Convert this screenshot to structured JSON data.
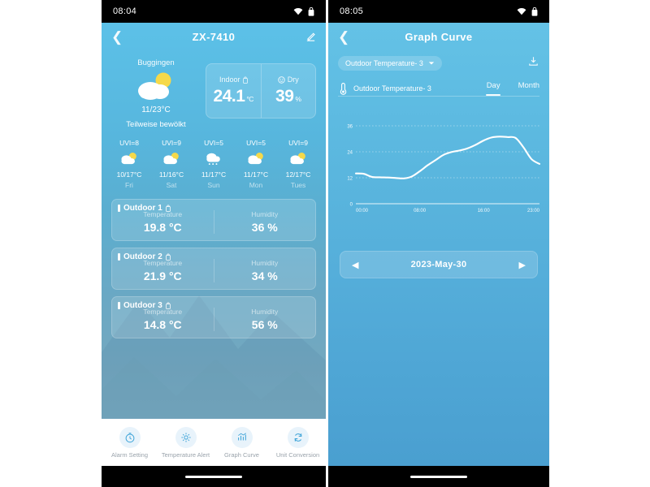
{
  "left_phone": {
    "status": {
      "time": "08:04",
      "wifi_icon": "wifi-icon",
      "battery_icon": "battery-icon"
    },
    "header": {
      "back_icon": "chevron-left-icon",
      "title": "ZX-7410",
      "edit_icon": "edit-pencil-icon"
    },
    "weather": {
      "city": "Buggingen",
      "icon": "sun-behind-cloud-icon",
      "range": "11/23°C",
      "description": "Teilweise bewölkt"
    },
    "indoor_card": {
      "left": {
        "label": "Indoor",
        "icon": "battery-icon",
        "value": "24.1",
        "unit": "°C"
      },
      "right": {
        "label": "Dry",
        "icon": "smiley-face-icon",
        "value": "39",
        "unit": "%"
      }
    },
    "forecast": [
      {
        "uvi": "UVI=8",
        "icon": "sun-behind-cloud-icon",
        "temp": "10/17°C",
        "day": "Fri"
      },
      {
        "uvi": "UVI=9",
        "icon": "sun-behind-cloud-icon",
        "temp": "11/16°C",
        "day": "Sat"
      },
      {
        "uvi": "UVI=5",
        "icon": "rain-cloud-icon",
        "temp": "11/17°C",
        "day": "Sun"
      },
      {
        "uvi": "UVI=5",
        "icon": "sun-behind-cloud-icon",
        "temp": "11/17°C",
        "day": "Mon"
      },
      {
        "uvi": "UVI=9",
        "icon": "sun-behind-cloud-icon",
        "temp": "12/17°C",
        "day": "Tues"
      }
    ],
    "sensors": [
      {
        "name": "Outdoor 1",
        "battery_icon": "battery-icon",
        "temperature_label": "Temperature",
        "temperature_value": "19.8 °C",
        "humidity_label": "Humidity",
        "humidity_value": "36 %"
      },
      {
        "name": "Outdoor 2",
        "battery_icon": "battery-icon",
        "temperature_label": "Temperature",
        "temperature_value": "21.9 °C",
        "humidity_label": "Humidity",
        "humidity_value": "34 %"
      },
      {
        "name": "Outdoor 3",
        "battery_icon": "battery-icon",
        "temperature_label": "Temperature",
        "temperature_value": "14.8 °C",
        "humidity_label": "Humidity",
        "humidity_value": "56 %"
      }
    ],
    "tabbar": [
      {
        "icon": "stopwatch-icon",
        "label": "Alarm Setting"
      },
      {
        "icon": "gear-icon",
        "label": "Temperature Alert"
      },
      {
        "icon": "chart-bars-icon",
        "label": "Graph Curve"
      },
      {
        "icon": "refresh-icon",
        "label": "Unit Conversion"
      }
    ]
  },
  "right_phone": {
    "status": {
      "time": "08:05",
      "wifi_icon": "wifi-icon",
      "battery_icon": "battery-icon"
    },
    "header": {
      "back_icon": "chevron-left-icon",
      "title": "Graph Curve"
    },
    "toolbar": {
      "dropdown_label": "Outdoor Temperature- 3",
      "dropdown_caret": "chevron-down-icon",
      "download_icon": "download-icon"
    },
    "legend": {
      "thermometer_icon": "thermometer-icon",
      "series_name": "Outdoor Temperature- 3",
      "range_tabs": [
        {
          "label": "Day",
          "active": true
        },
        {
          "label": "Month",
          "active": false
        }
      ]
    },
    "date_nav": {
      "prev_icon": "triangle-left-icon",
      "label": "2023-May-30",
      "next_icon": "triangle-right-icon"
    }
  },
  "chart_data": {
    "type": "line",
    "title": "Outdoor Temperature- 3",
    "xlabel": "",
    "ylabel": "",
    "grid": true,
    "legend_position": "top-left",
    "line_color": "#ffffff",
    "ylim": [
      0,
      36
    ],
    "yticks": [
      0,
      12,
      24,
      36
    ],
    "xticks": [
      "00:00",
      "08:00",
      "16:00",
      "23:00"
    ],
    "x": [
      "00:00",
      "01:00",
      "02:00",
      "03:00",
      "04:00",
      "05:00",
      "06:00",
      "07:00",
      "08:00",
      "09:00",
      "10:00",
      "11:00",
      "12:00",
      "13:00",
      "14:00",
      "15:00",
      "16:00",
      "17:00",
      "18:00",
      "19:00",
      "20:00",
      "21:00",
      "22:00",
      "23:00"
    ],
    "series": [
      {
        "name": "Outdoor Temperature- 3",
        "values": [
          14.0,
          13.8,
          12.4,
          12.2,
          12.1,
          11.9,
          11.7,
          12.6,
          15.0,
          17.8,
          20.2,
          22.6,
          23.9,
          24.6,
          25.6,
          27.2,
          29.2,
          30.6,
          31.0,
          30.8,
          30.4,
          26.0,
          20.6,
          18.4
        ]
      }
    ]
  }
}
